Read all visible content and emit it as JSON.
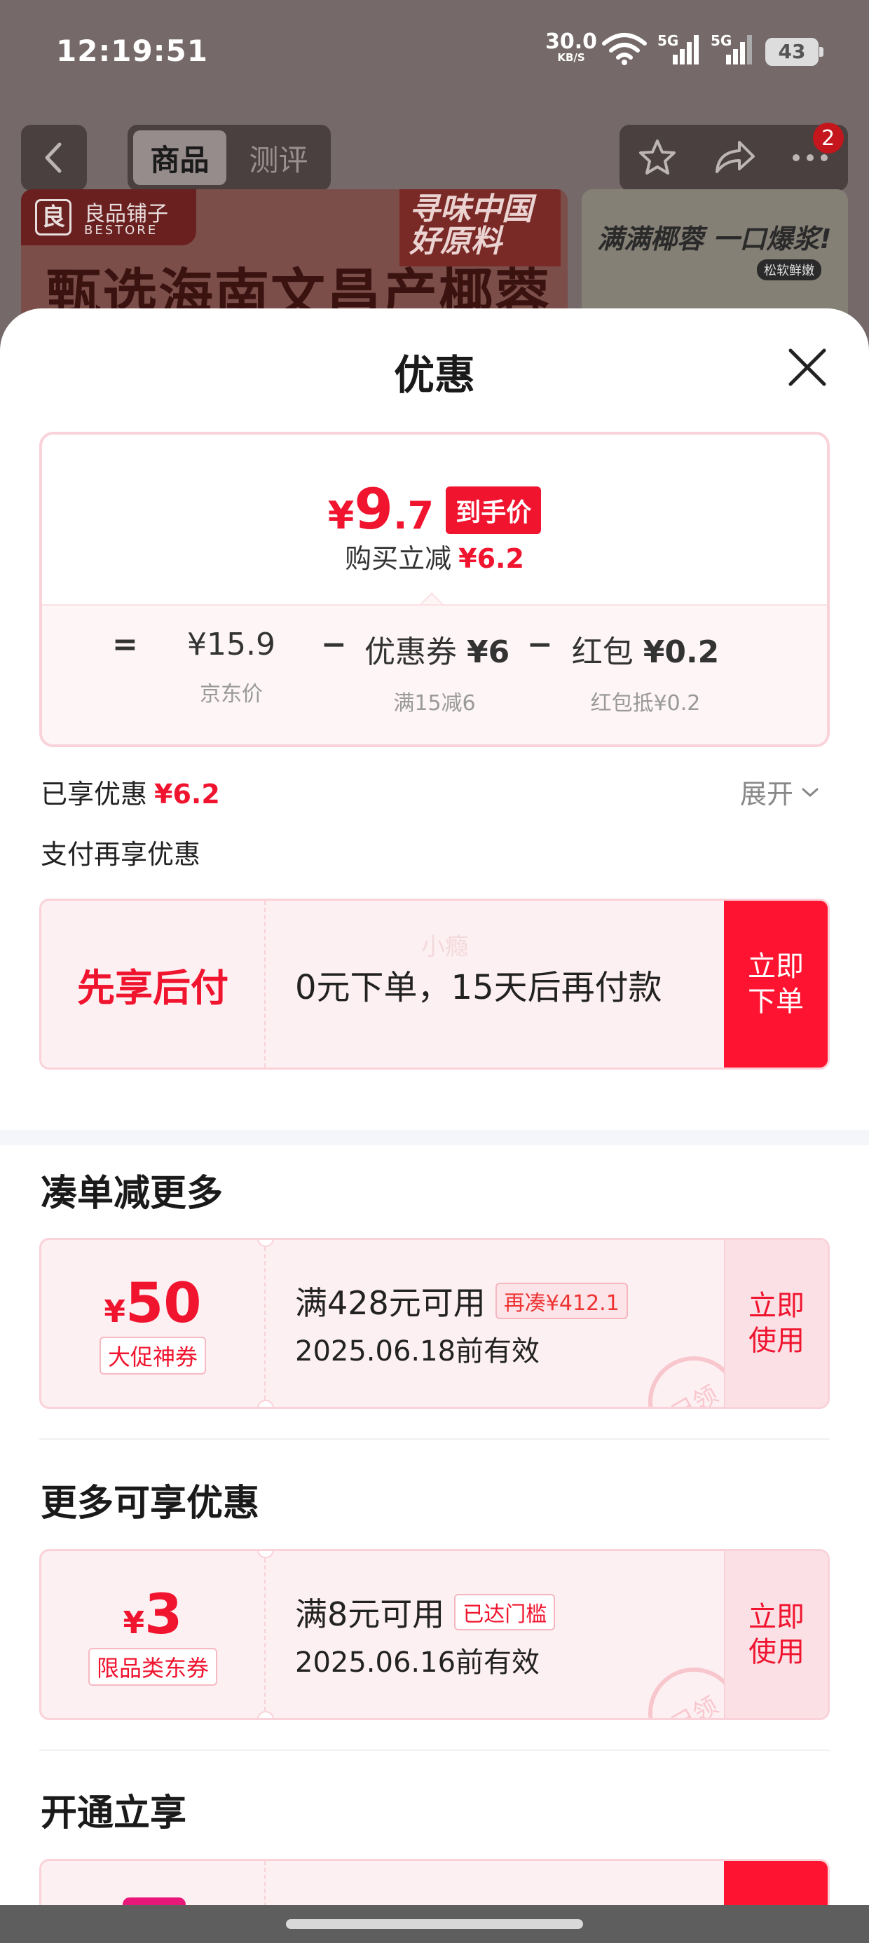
{
  "status_bar": {
    "time": "12:19:51",
    "net_speed": "30.0",
    "net_unit": "KB/S",
    "signal1": "5G",
    "signal2": "5G",
    "battery": "43"
  },
  "header": {
    "tabs": [
      {
        "label": "商品",
        "active": true
      },
      {
        "label": "测评",
        "active": false
      }
    ],
    "icons": [
      "back-arrow-icon",
      "star-icon",
      "share-icon",
      "more-icon"
    ],
    "notification_count": "2"
  },
  "banner": {
    "store_name": "良品铺子",
    "store_en": "BESTORE",
    "slogan": "寻味中国 好原料",
    "headline": "甄选海南文昌产椰蓉",
    "right_tagline": "满满椰蓉 一口爆浆!",
    "right_tag": "松软鲜嫩"
  },
  "sheet": {
    "title": "优惠",
    "price_card": {
      "currency": "¥",
      "final_price_int": "9",
      "final_price_dec": ".7",
      "final_tag": "到手价",
      "instant_discount_label": "购买立减",
      "instant_discount_value": "¥6.2",
      "formula": {
        "equals": "=",
        "minus": "−",
        "base_price": "¥15.9",
        "base_label": "京东价",
        "coupon_name": "优惠券",
        "coupon_value": "¥6",
        "coupon_label": "满15减6",
        "redpack_name": "红包",
        "redpack_value": "¥0.2",
        "redpack_label": "红包抵¥0.2"
      }
    },
    "enjoyed_label": "已享优惠",
    "enjoyed_value": "¥6.2",
    "expand_label": "展开",
    "pay_more_label": "支付再享优惠",
    "bnpl": {
      "title": "先享后付",
      "desc": "0元下单，15天后再付款",
      "watermark": "小瘾",
      "action_line1": "立即",
      "action_line2": "下单"
    },
    "section_bundle": {
      "title": "凑单减更多",
      "coupon": {
        "currency": "¥",
        "amount": "50",
        "label": "大促神券",
        "condition": "满428元可用",
        "chip": "再凑¥412.1",
        "valid": "2025.06.18前有效",
        "stamp": "已领",
        "action_line1": "立即",
        "action_line2": "使用"
      }
    },
    "section_more": {
      "title": "更多可享优惠",
      "coupon": {
        "currency": "¥",
        "amount": "3",
        "label": "限品类东券",
        "condition": "满8元可用",
        "chip": "已达门槛",
        "valid": "2025.06.16前有效",
        "stamp": "已领",
        "action_line1": "立即",
        "action_line2": "使用"
      }
    },
    "section_open": {
      "title": "开通立享"
    }
  },
  "colors": {
    "accent_red": "#f0142f",
    "button_red": "#fe1430",
    "coupon_bg": "#fdf0f2",
    "card_border": "#fad2d9"
  }
}
